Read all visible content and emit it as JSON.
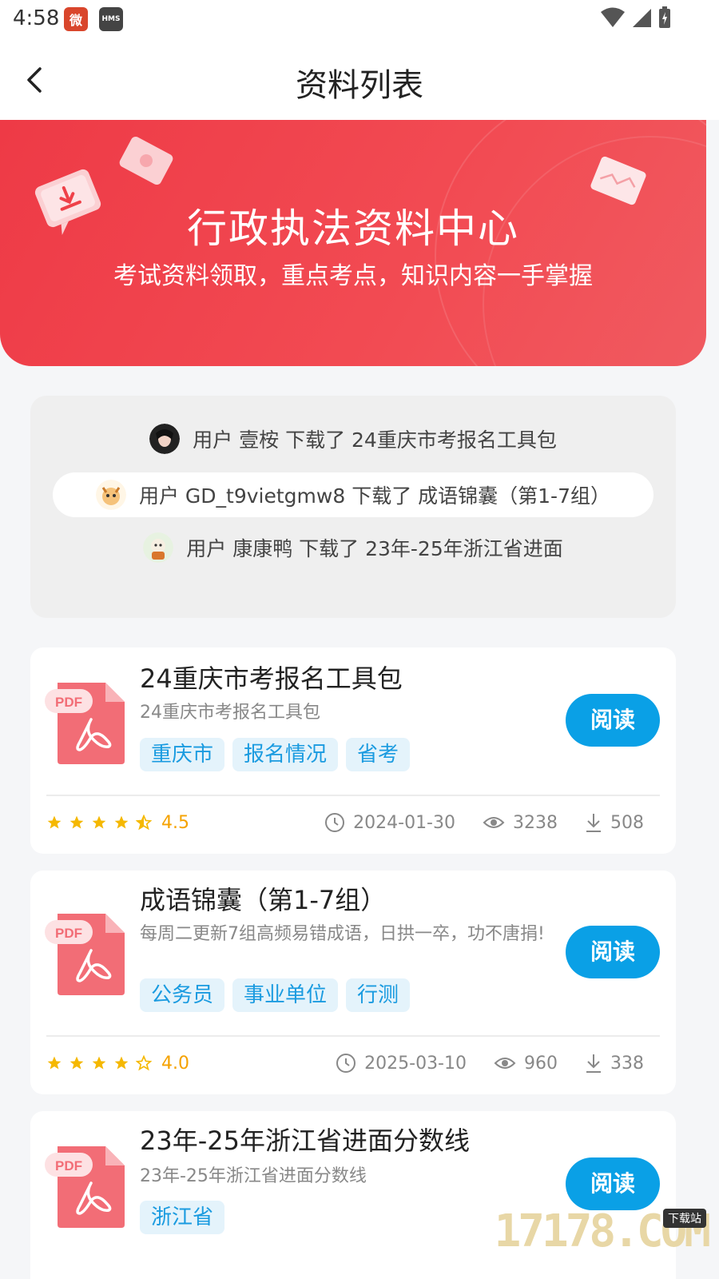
{
  "status": {
    "time": "4:58",
    "app1": "微",
    "app2": "HMS"
  },
  "header": {
    "title": "资料列表"
  },
  "banner": {
    "title": "行政执法资料中心",
    "subtitle": "考试资料领取，重点考点，知识内容一手掌握"
  },
  "feed": [
    {
      "text": "用户 壹桉 下载了 24重庆市考报名工具包"
    },
    {
      "text": "用户 GD_t9vietgmw8 下载了 成语锦囊（第1-7组）"
    },
    {
      "text": "用户 康康鸭 下载了 23年-25年浙江省进面"
    }
  ],
  "docs": [
    {
      "title": "24重庆市考报名工具包",
      "desc": "24重庆市考报名工具包",
      "tags": [
        "重庆市",
        "报名情况",
        "省考"
      ],
      "read": "阅读",
      "rating": "4.5",
      "stars": 4.5,
      "date": "2024-01-30",
      "views": "3238",
      "downloads": "508"
    },
    {
      "title": "成语锦囊（第1-7组）",
      "desc": "每周二更新7组高频易错成语，日拱一卒，功不唐捐!",
      "tags": [
        "公务员",
        "事业单位",
        "行测"
      ],
      "read": "阅读",
      "rating": "4.0",
      "stars": 4.0,
      "date": "2025-03-10",
      "views": "960",
      "downloads": "338"
    },
    {
      "title": "23年-25年浙江省进面分数线",
      "desc": "23年-25年浙江省进面分数线",
      "tags": [
        "浙江省"
      ],
      "read": "阅读"
    }
  ],
  "icons": {
    "pdf": "PDF",
    "clock": "clock-icon",
    "eye": "eye-icon",
    "download": "download-icon"
  },
  "watermark": {
    "text": "17178.COM",
    "tag": "下载站"
  },
  "colors": {
    "banner": "#ef4149",
    "accent": "#0aa0e6",
    "star": "#f5b800",
    "tag_bg": "#e4f3fb",
    "tag_text": "#1a9be0"
  }
}
